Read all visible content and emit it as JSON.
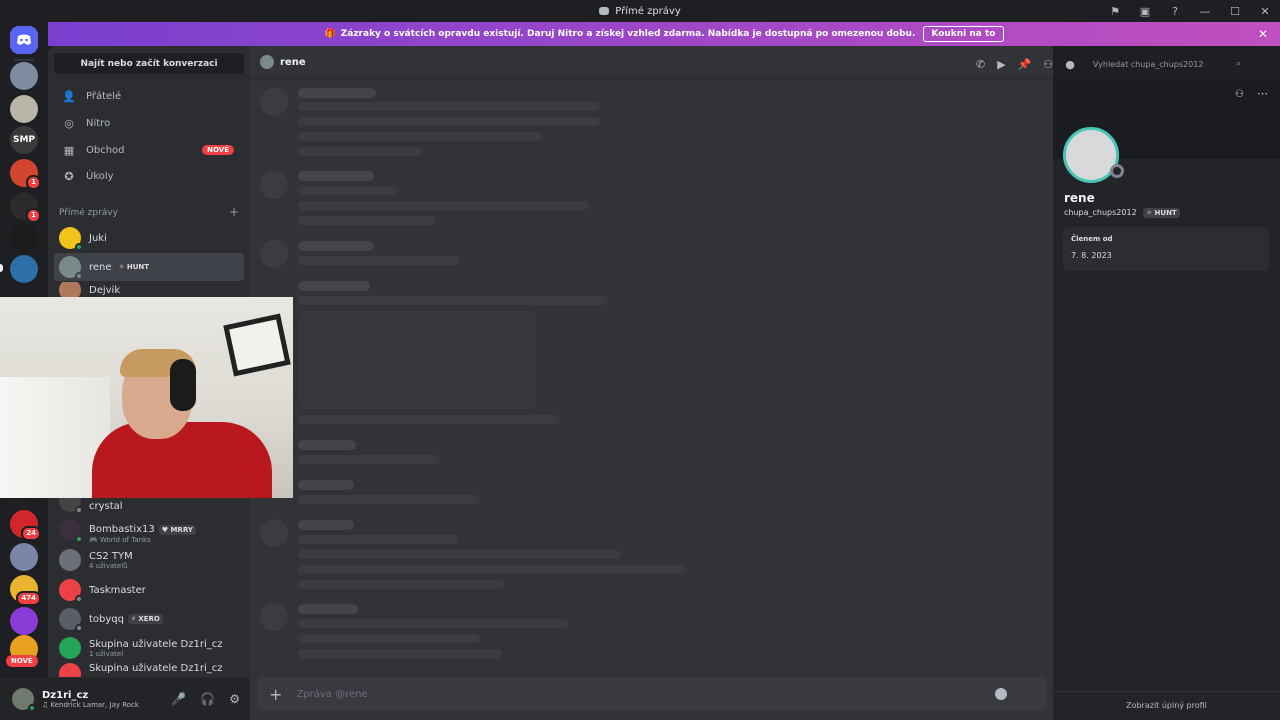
{
  "window": {
    "title": "Přímé zprávy",
    "controls": [
      "—",
      "☐",
      "✕"
    ]
  },
  "banner": {
    "text": "Zázraky o svátcích opravdu existují. Daruj Nitro a získej vzhled zdarma. Nabídka je dostupná po omezenou dobu.",
    "button": "Koukni na to"
  },
  "servers": {
    "new_label": "NOVÉ",
    "items": [
      {
        "label": "",
        "badge": ""
      },
      {
        "label": "",
        "badge": ""
      },
      {
        "label": "SMP",
        "badge": ""
      },
      {
        "label": "",
        "badge": "1"
      },
      {
        "label": "",
        "badge": "1"
      },
      {
        "label": "",
        "badge": ""
      },
      {
        "label": "",
        "badge": ""
      },
      {
        "label": "",
        "badge": "24"
      },
      {
        "label": "",
        "badge": ""
      },
      {
        "label": "",
        "badge": "474"
      },
      {
        "label": "",
        "badge": ""
      }
    ]
  },
  "sidebar": {
    "find_button": "Najít nebo začít konverzaci",
    "nav": [
      {
        "label": "Přátelé",
        "icon": "friends-icon"
      },
      {
        "label": "Nitro",
        "icon": "nitro-icon"
      },
      {
        "label": "Obchod",
        "icon": "shop-icon",
        "badge": "NOVÉ"
      },
      {
        "label": "Úkoly",
        "icon": "quests-icon"
      }
    ],
    "dm_header": "Přímé zprávy",
    "dm_add": "+",
    "dms_top": [
      {
        "name": "Juki",
        "tag": "",
        "sub": "",
        "color": "#f0c419",
        "status": "#23a55a"
      },
      {
        "name": "rene",
        "tag": "✧ HUNT",
        "sub": "",
        "color": "#7a8a88",
        "status": "#80848e"
      },
      {
        "name": "Dejvik",
        "tag": "",
        "sub": "",
        "color": "#b07a5a",
        "status": "#80848e"
      }
    ],
    "dms_bottom": [
      {
        "name": "crystal",
        "tag": "",
        "sub": "",
        "color": "#444",
        "status": "#80848e"
      },
      {
        "name": "Bombastix13",
        "tag": "♥ MRRY",
        "sub": "🎮 World of Tanks",
        "color": "#3b2e3f",
        "status": "#23a55a"
      },
      {
        "name": "CS2 TYM",
        "tag": "",
        "sub": "4 uživatelů",
        "color": "#6b6f7a",
        "status": ""
      },
      {
        "name": "Taskmaster",
        "tag": "",
        "sub": "",
        "color": "#ed4245",
        "status": "#80848e"
      },
      {
        "name": "tobyqq",
        "tag": "⚡ XERO",
        "sub": "",
        "color": "#5a5e66",
        "status": "#80848e"
      },
      {
        "name": "Skupina uživatele Dz1ri_cz",
        "tag": "",
        "sub": "1 uživatel",
        "color": "#23a55a",
        "status": ""
      },
      {
        "name": "Skupina uživatele Dz1ri_cz",
        "tag": "",
        "sub": "",
        "color": "#ed4245",
        "status": ""
      }
    ]
  },
  "user": {
    "name": "Dz1ri_cz",
    "status": "♫ Kendrick Lamar, Jay Rock"
  },
  "chat": {
    "channel_name": "rene",
    "search_placeholder": "Vyhledat chupa_chups2012",
    "composer_placeholder": "Zpráva @rene"
  },
  "profile": {
    "display_name": "rene",
    "username": "chupa_chups2012",
    "tag": "✧ HUNT",
    "member_since_label": "Členem od",
    "member_since": "7. 8. 2023",
    "full_profile": "Zobrazit úplný profil"
  },
  "colors": {
    "discord_blurple": "#5865f2",
    "online": "#23a55a",
    "offline": "#80848e",
    "badge_red": "#f23f43"
  }
}
